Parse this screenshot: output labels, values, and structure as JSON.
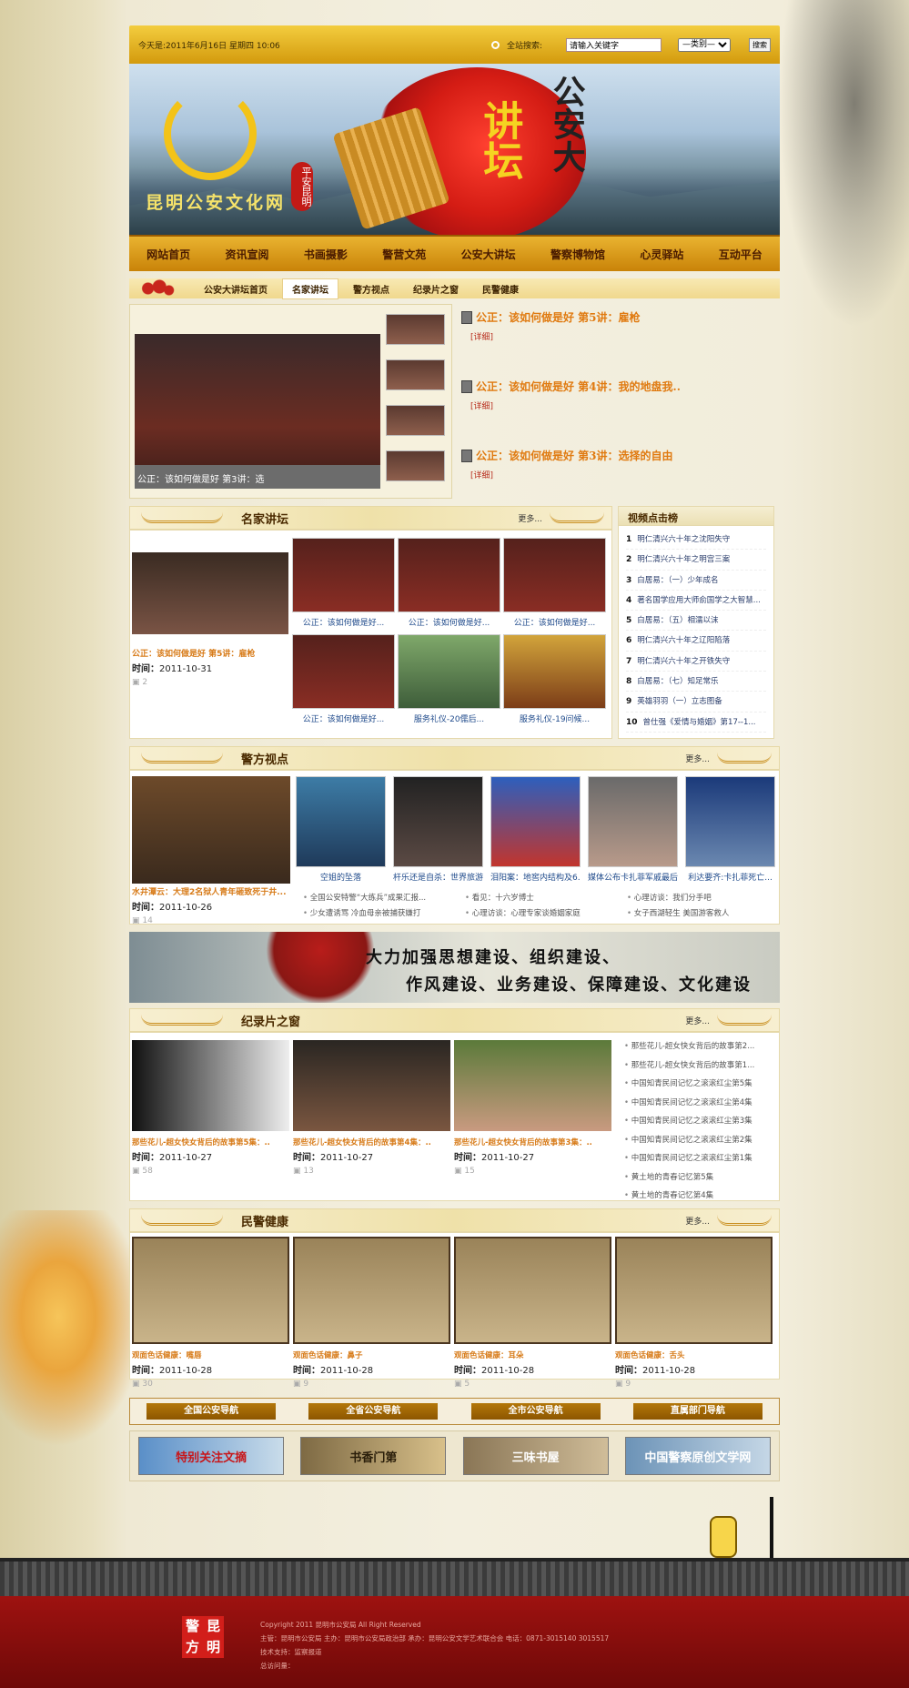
{
  "topbar": {
    "date": "今天是:2011年6月16日 星期四 10:06",
    "search_label": "全站搜索:",
    "search_placeholder": "请输入关键字",
    "category_select": "—类别—",
    "search_button": "搜索"
  },
  "banner": {
    "site_name": "昆明公安文化网",
    "seal_text": "平安昆明",
    "headline_small": "公安大",
    "headline_big": "讲坛"
  },
  "nav": [
    "网站首页",
    "资讯宣阅",
    "书画摄影",
    "警营文苑",
    "公安大讲坛",
    "警察博物馆",
    "心灵驿站",
    "互动平台"
  ],
  "subtabs": [
    "公安大讲坛首页",
    "名家讲坛",
    "警方视点",
    "纪录片之窗",
    "民警健康"
  ],
  "feature": {
    "player_caption": "公正：该如何做是好 第3讲：选",
    "items": [
      {
        "title": "公正：该如何做是好 第5讲：雇枪",
        "more": "[详细]"
      },
      {
        "title": "公正：该如何做是好 第4讲：我的地盘我..",
        "more": "[详细]"
      },
      {
        "title": "公正：该如何做是好 第3讲：选择的自由",
        "more": "[详细]"
      }
    ]
  },
  "mjjt": {
    "title": "名家讲坛",
    "more": "更多...",
    "lead_title": "公正：该如何做是好 第5讲：雇枪",
    "time_label": "时间：",
    "lead_time": "2011-10-31",
    "lead_count": "2",
    "grid": [
      "公正：该如何做是好...",
      "公正：该如何做是好...",
      "公正：该如何做是好...",
      "公正：该如何做是好...",
      "服务礼仪-20儒后...",
      "服务礼仪-19问候..."
    ]
  },
  "rank": {
    "title": "视频点击榜",
    "items": [
      {
        "n": "1",
        "t": "明仁清兴六十年之沈阳失守"
      },
      {
        "n": "2",
        "t": "明仁清兴六十年之明宫三案"
      },
      {
        "n": "3",
        "t": "白居易：（一）少年成名"
      },
      {
        "n": "4",
        "t": "著名国学应用大师俞国学之大智慧..."
      },
      {
        "n": "5",
        "t": "白居易：（五）相濡以沫"
      },
      {
        "n": "6",
        "t": "明仁清兴六十年之辽阳陷落"
      },
      {
        "n": "7",
        "t": "明仁清兴六十年之开铁失守"
      },
      {
        "n": "8",
        "t": "白居易：（七）知足常乐"
      },
      {
        "n": "9",
        "t": "英雄羽羽（一）立志图备"
      },
      {
        "n": "10",
        "t": "曾仕强《爱情与婚姻》第17--1..."
      }
    ]
  },
  "jfsd": {
    "title": "警方视点",
    "more": "更多...",
    "lead_title": "水井潭云：大理2名狱人青年砸致死于井...",
    "time_label": "时间：",
    "lead_time": "2011-10-26",
    "lead_count": "14",
    "thumbs": [
      "空姐的坠落",
      "杆乐还是自杀：世界旅游...",
      "泪阳案：地窖内结构及6...",
      "媒体公布卡扎菲军戚最后...",
      "利达要齐:卡扎菲死亡..."
    ],
    "links": [
      "全国公安特警“大练兵”成果汇报...",
      "看见：十六岁博士",
      "心理访谈：我们分手吧",
      "少女遭诱骂 冷血母亲被捕获嫌打",
      "心理访谈：心理专家谈婚姻家庭",
      "女子西湖轻生 美国游客救人"
    ]
  },
  "slogan": {
    "line1": "大力加强思想建设、组织建设、",
    "line2": "作风建设、业务建设、保障建设、文化建设"
  },
  "jlp": {
    "title": "纪录片之窗",
    "more": "更多...",
    "time_label": "时间：",
    "cards": [
      {
        "title": "那些花儿-超女快女背后的故事第5集：..",
        "time": "2011-10-27",
        "count": "58"
      },
      {
        "title": "那些花儿-超女快女背后的故事第4集：..",
        "time": "2011-10-27",
        "count": "13"
      },
      {
        "title": "那些花儿-超女快女背后的故事第3集：..",
        "time": "2011-10-27",
        "count": "15"
      }
    ],
    "side": [
      "那些花儿-超女快女背后的故事第2...",
      "那些花儿-超女快女背后的故事第1...",
      "中国知青民间记忆之滚滚红尘第5集",
      "中国知青民间记忆之滚滚红尘第4集",
      "中国知青民间记忆之滚滚红尘第3集",
      "中国知青民间记忆之滚滚红尘第2集",
      "中国知青民间记忆之滚滚红尘第1集",
      "黄土地的青春记忆第5集",
      "黄土地的青春记忆第4集"
    ]
  },
  "mjjk": {
    "title": "民警健康",
    "more": "更多...",
    "time_label": "时间：",
    "cards": [
      {
        "title": "观面色话健康：嘴唇",
        "time": "2011-10-28",
        "count": "30"
      },
      {
        "title": "观面色话健康：鼻子",
        "time": "2011-10-28",
        "count": "9"
      },
      {
        "title": "观面色话健康：耳朵",
        "time": "2011-10-28",
        "count": "5"
      },
      {
        "title": "观面色话健康：舌头",
        "time": "2011-10-28",
        "count": "9"
      }
    ]
  },
  "navlinks": [
    "全国公安导航",
    "全省公安导航",
    "全市公安导航",
    "直属部门导航"
  ],
  "logos": [
    "特别关注文摘",
    "书香门第",
    "三味书屋",
    "中国警察原创文学网"
  ],
  "footer": {
    "seal": [
      "警",
      "昆",
      "方",
      "明"
    ],
    "copyright": "Copyright 2011 昆明市公安局 All Right Reserved",
    "line2": "主管：昆明市公安局     主办：昆明市公安局政治部     承办：昆明公安文学艺术联合会     电话：0871-3015140 3015517",
    "line3": "技术支持：监察报道",
    "line4": "总访问量："
  }
}
